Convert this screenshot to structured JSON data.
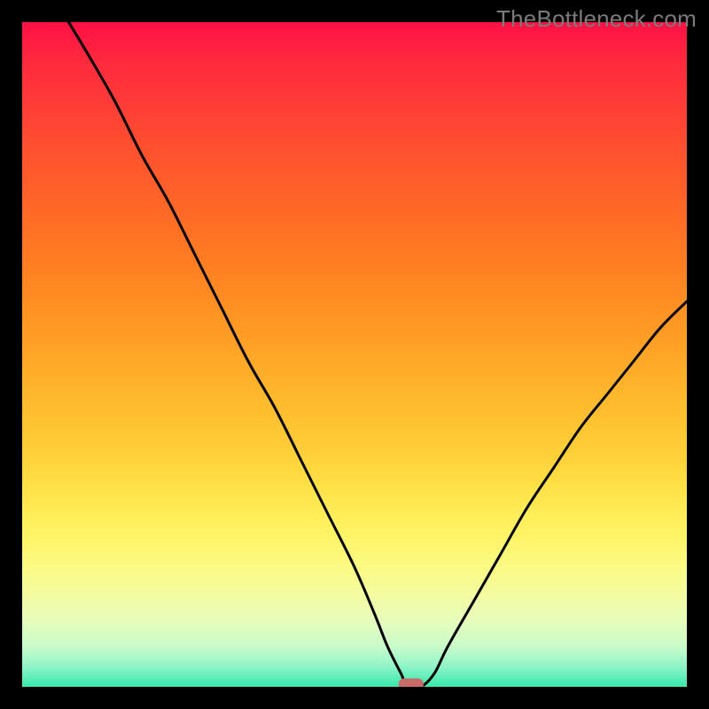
{
  "watermark": "TheBottleneck.com",
  "chart_data": {
    "type": "line",
    "title": "",
    "xlabel": "",
    "ylabel": "",
    "xlim": [
      0,
      100
    ],
    "ylim": [
      0,
      100
    ],
    "grid": false,
    "background_gradient": {
      "top": "#ff1044",
      "mid": "#ffe148",
      "bottom": "#36e8ac"
    },
    "series": [
      {
        "name": "bottleneck-curve",
        "color": "#000000",
        "x": [
          7,
          10,
          14,
          18,
          22,
          26,
          30,
          34,
          38,
          42,
          46,
          50,
          53,
          55,
          57,
          58,
          60,
          62,
          64,
          68,
          72,
          76,
          80,
          84,
          88,
          92,
          96,
          100
        ],
        "y": [
          100,
          95,
          88,
          80,
          73,
          65,
          57,
          49,
          42,
          34,
          26,
          18,
          11,
          6,
          2,
          0,
          0,
          2,
          6,
          13,
          20,
          27,
          33,
          39,
          44,
          49,
          54,
          58
        ]
      }
    ],
    "marker": {
      "name": "optimal-point",
      "x": 58.5,
      "y": 0,
      "color": "#c96a6a",
      "shape": "rounded-rect"
    }
  }
}
